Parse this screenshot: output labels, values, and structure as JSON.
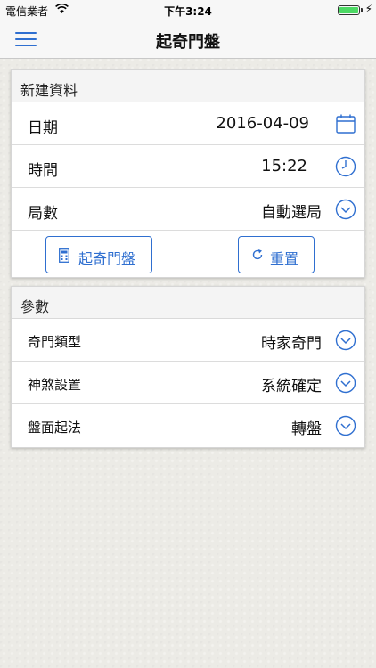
{
  "status_bar": {
    "carrier": "電信業者",
    "time": "下午3:24"
  },
  "nav": {
    "title": "起奇門盤",
    "menu_icon": "hamburger-menu-icon"
  },
  "new_data": {
    "header": "新建資料",
    "date_label": "日期",
    "date_value": "2016-04-09",
    "time_label": "時間",
    "time_value": "15:22",
    "ju_label": "局數",
    "ju_value": "自動選局",
    "calc_button": "起奇門盤",
    "reset_button": "重置"
  },
  "params": {
    "header": "參數",
    "type_label": "奇門類型",
    "type_value": "時家奇門",
    "shensha_label": "神煞設置",
    "shensha_value": "系統確定",
    "pan_label": "盤面起法",
    "pan_value": "轉盤"
  },
  "colors": {
    "accent": "#2f6fd0",
    "battery": "#4cd964"
  }
}
